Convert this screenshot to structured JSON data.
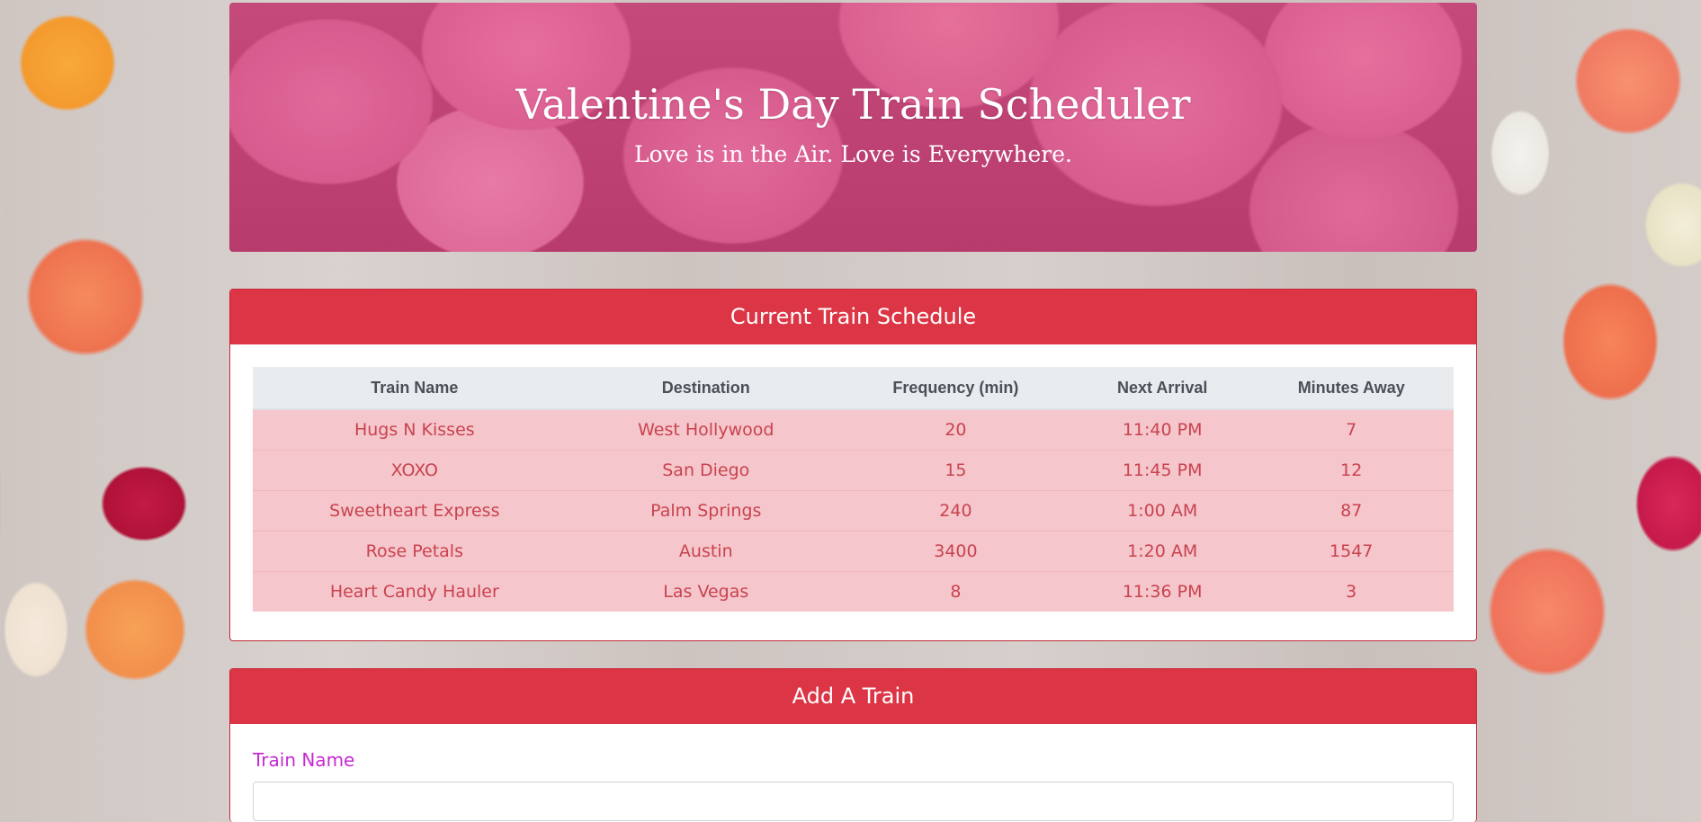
{
  "header": {
    "title": "Valentine's Day Train Scheduler",
    "subtitle": "Love is in the Air. Love is Everywhere."
  },
  "schedule": {
    "title": "Current Train Schedule",
    "columns": [
      "Train Name",
      "Destination",
      "Frequency (min)",
      "Next Arrival",
      "Minutes Away"
    ],
    "rows": [
      [
        "Hugs N Kisses",
        "West Hollywood",
        "20",
        "11:40 PM",
        "7"
      ],
      [
        "XOXO",
        "San Diego",
        "15",
        "11:45 PM",
        "12"
      ],
      [
        "Sweetheart Express",
        "Palm Springs",
        "240",
        "1:00 AM",
        "87"
      ],
      [
        "Rose Petals",
        "Austin",
        "3400",
        "1:20 AM",
        "1547"
      ],
      [
        "Heart Candy Hauler",
        "Las Vegas",
        "8",
        "11:36 PM",
        "3"
      ]
    ]
  },
  "add_train": {
    "title": "Add A Train",
    "train_name_label": "Train Name",
    "train_name_value": ""
  },
  "colors": {
    "header_red": "#dc3545",
    "row_pink": "#f5c6cb",
    "label_magenta": "#c52bd1"
  }
}
